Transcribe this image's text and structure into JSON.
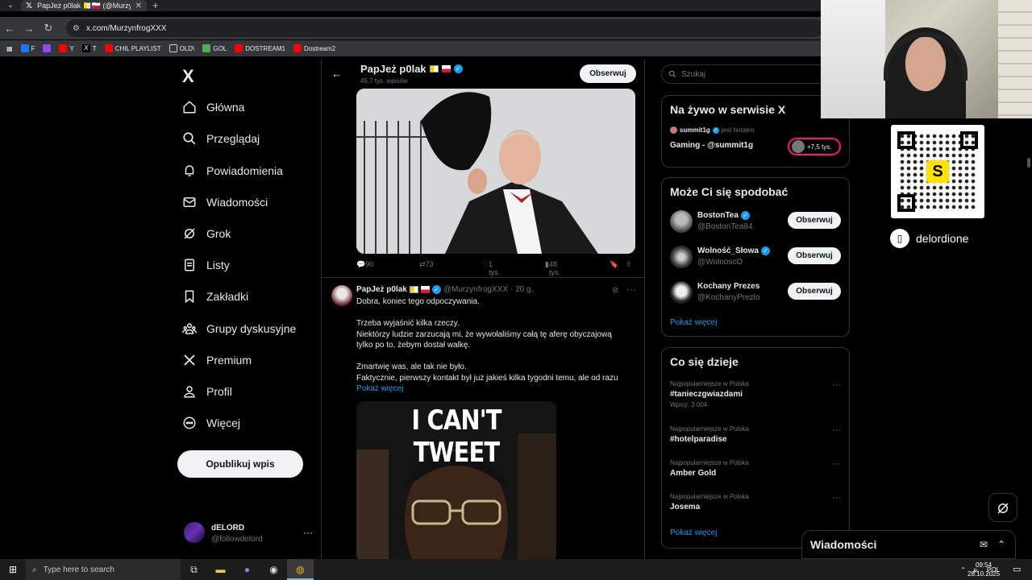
{
  "browser": {
    "tab_title": "PapJeż p0lak 🇻🇦🇵🇱 (@MurzynfrogXXX",
    "url": "x.com/MurzynfrogXXX",
    "bookmarks": [
      {
        "label": "F",
        "color": "#1877f2"
      },
      {
        "label": "",
        "color": "#9146ff"
      },
      {
        "label": "Y",
        "color": "#ff0000"
      },
      {
        "label": "T",
        "color": "#ffffff"
      },
      {
        "label": "CHIL PLAYLIST",
        "color": "#ff0000"
      },
      {
        "label": "OLD\\",
        "color": "#cccccc"
      },
      {
        "label": "GOL",
        "color": "#55aa55"
      },
      {
        "label": "DOSTREAM1",
        "color": "#ff0000"
      },
      {
        "label": "Dostream2",
        "color": "#ff0000"
      }
    ]
  },
  "sidebar": {
    "logo": "X",
    "items": [
      {
        "label": "Główna",
        "icon": "home-icon"
      },
      {
        "label": "Przeglądaj",
        "icon": "search-icon"
      },
      {
        "label": "Powiadomienia",
        "icon": "bell-icon"
      },
      {
        "label": "Wiadomości",
        "icon": "mail-icon"
      },
      {
        "label": "Grok",
        "icon": "grok-icon"
      },
      {
        "label": "Listy",
        "icon": "list-icon"
      },
      {
        "label": "Zakładki",
        "icon": "bookmark-icon"
      },
      {
        "label": "Grupy dyskusyjne",
        "icon": "people-icon"
      },
      {
        "label": "Premium",
        "icon": "x-premium-icon"
      },
      {
        "label": "Profil",
        "icon": "person-icon"
      },
      {
        "label": "Więcej",
        "icon": "more-circle-icon"
      }
    ],
    "publish_label": "Opublikuj wpis",
    "account": {
      "name": "dELORD",
      "handle": "@followdelord"
    }
  },
  "profile_header": {
    "name": "PapJeż p0lak",
    "post_count": "45,7 tys. wpisów",
    "follow_label": "Obserwuj"
  },
  "post1": {
    "replies": "90",
    "reposts": "73",
    "likes": "1 tys.",
    "views": "48 tys."
  },
  "post2": {
    "name": "PapJeż p0lak",
    "handle": "@MurzynfrogXXX",
    "time": "· 20 g.",
    "lines": [
      "Dobra, koniec tego odpoczywania.",
      "",
      "Trzeba wyjaśnić kilka rzeczy.",
      "Niektórzy ludzie zarzucają mi, że wywołaliśmy całą tę aferę obyczajową",
      "tylko po to, żebym dostał walkę.",
      "",
      "Zmartwię was, ale tak nie było.",
      "Faktycznie, pierwszy kontakt był już jakieś kilka tygodni temu, ale od razu"
    ],
    "show_more": "Pokaż więcej",
    "image_caption": "I CAN'T TWEET"
  },
  "right": {
    "search_placeholder": "Szukaj",
    "live": {
      "title": "Na żywo w serwisie X",
      "host": "summit1g",
      "host_suffix": "jest hostem",
      "stream_title": "Gaming - @summit1g",
      "listeners": "+7,5 tys."
    },
    "suggest": {
      "title": "Może Ci się spodobać",
      "users": [
        {
          "name": "BostonTea",
          "handle": "@BostonTea84",
          "verified": true
        },
        {
          "name": "Wolność_Słowa",
          "handle": "@WolnoscO",
          "verified": true
        },
        {
          "name": "Kochany Prezes",
          "handle": "@KochanyPrezlo",
          "verified": false
        }
      ],
      "follow_label": "Obserwuj",
      "more_label": "Pokaż więcej"
    },
    "trends": {
      "title": "Co się dzieje",
      "items": [
        {
          "context": "Najpopularniejsze w Polska",
          "name": "#tanieczgwiazdami",
          "posts": "Wpisy: 3 004"
        },
        {
          "context": "Najpopularniejsze w Polska",
          "name": "#hotelparadise",
          "posts": ""
        },
        {
          "context": "Najpopularniejsze w Polska",
          "name": "Amber Gold",
          "posts": ""
        },
        {
          "context": "Najpopularniejsze w Polska",
          "name": "Josema",
          "posts": ""
        }
      ],
      "more_label": "Pokaż więcej"
    }
  },
  "overlay": {
    "qr_letter": "S",
    "handle": "delordione"
  },
  "messages_bar": {
    "title": "Wiadomości"
  },
  "taskbar": {
    "search_placeholder": "Type here to search",
    "lang": "POL",
    "time": "09:54",
    "date": "28.10.2025"
  }
}
